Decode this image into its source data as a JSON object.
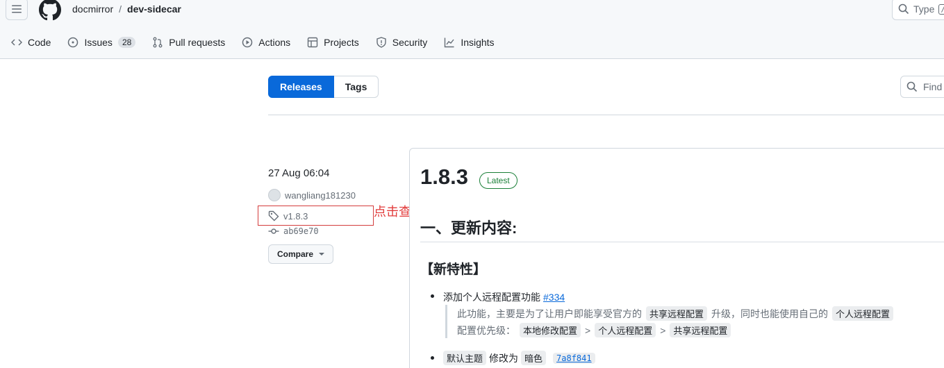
{
  "header": {
    "owner": "docmirror",
    "separator": "/",
    "repo": "dev-sidecar",
    "search_placeholder": "Type",
    "search_kbd": "/"
  },
  "nav": [
    {
      "label": "Code",
      "icon": "code-icon"
    },
    {
      "label": "Issues",
      "icon": "issue-icon",
      "count": "28"
    },
    {
      "label": "Pull requests",
      "icon": "pull-request-icon"
    },
    {
      "label": "Actions",
      "icon": "play-icon"
    },
    {
      "label": "Projects",
      "icon": "table-icon"
    },
    {
      "label": "Security",
      "icon": "shield-icon"
    },
    {
      "label": "Insights",
      "icon": "graph-icon"
    }
  ],
  "subnav": {
    "releases": "Releases",
    "tags": "Tags",
    "find_placeholder": "Find"
  },
  "release": {
    "date": "27 Aug 06:04",
    "author": "wangliang181230",
    "tag": "v1.8.3",
    "commit": "ab69e70",
    "compare": "Compare",
    "annotation": "点击查看文档说明及下载工具",
    "version": "1.8.3",
    "latest": "Latest",
    "heading1": "一、更新内容:",
    "heading2": "【新特性】",
    "item1_text": "添加个人远程配置功能",
    "item1_link": "#334",
    "quote_line1_a": "此功能，主要是为了让用户即能享受官方的",
    "quote_line1_code1": "共享远程配置",
    "quote_line1_b": "升级，同时也能使用自己的",
    "quote_line1_code2": "个人远程配置",
    "quote_line2_a": "配置优先级：",
    "quote_line2_code1": "本地修改配置",
    "quote_line2_sep1": ">",
    "quote_line2_code2": "个人远程配置",
    "quote_line2_sep2": ">",
    "quote_line2_code3": "共享远程配置",
    "item2_code1": "默认主题",
    "item2_text": "修改为",
    "item2_code2": "暗色",
    "item2_commit": "7a8f841"
  },
  "colors": {
    "accent": "#0969da",
    "latest": "#1a7f37",
    "annotation": "#e23b3b"
  }
}
